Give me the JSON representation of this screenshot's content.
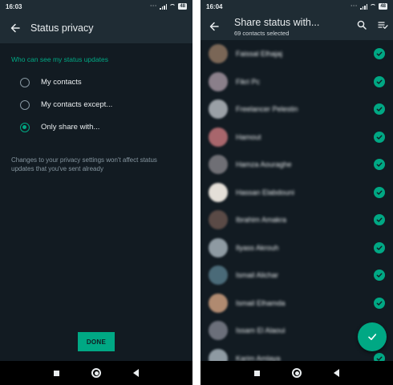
{
  "left": {
    "status_bar": {
      "time": "16:03",
      "battery": "48"
    },
    "title": "Status privacy",
    "section_label": "Who can see my status updates",
    "options": [
      {
        "label": "My contacts",
        "selected": false
      },
      {
        "label": "My contacts except...",
        "selected": false
      },
      {
        "label": "Only share with...",
        "selected": true
      }
    ],
    "note": "Changes to your privacy settings won't affect status updates that you've sent already",
    "done_label": "DONE"
  },
  "right": {
    "status_bar": {
      "time": "16:04",
      "battery": "48"
    },
    "title": "Share status with...",
    "subtitle": "69 contacts selected",
    "contacts": [
      {
        "name": "Faissal Elhajaj",
        "avatar": "#7a6656",
        "checked": true
      },
      {
        "name": "Fikri Pc",
        "avatar": "#8a7f8a",
        "checked": true
      },
      {
        "name": "Freelancer Pelestin",
        "avatar": "#9aa0a6",
        "checked": true
      },
      {
        "name": "Hamout",
        "avatar": "#a8666c",
        "checked": true
      },
      {
        "name": "Hamza Aouraghe",
        "avatar": "#6f6f75",
        "checked": true
      },
      {
        "name": "Hassan Elabdouni",
        "avatar": "#e4dfd8",
        "checked": true
      },
      {
        "name": "Ibrahim Amakra",
        "avatar": "#5a4a46",
        "checked": true
      },
      {
        "name": "Ilyass Akrouh",
        "avatar": "#8e9aa2",
        "checked": true
      },
      {
        "name": "Ismail Alichar",
        "avatar": "#4a6a78",
        "checked": true
      },
      {
        "name": "Ismail Elhamda",
        "avatar": "#b08a70",
        "checked": true
      },
      {
        "name": "Issam El Alaoui",
        "avatar": "#6b6f7a",
        "checked": true
      },
      {
        "name": "Karim Amlaya",
        "avatar": "#8e9aa2",
        "checked": true
      }
    ],
    "colors": {
      "accent": "#00a884",
      "background": "#121b22",
      "header": "#1f2c34"
    }
  }
}
